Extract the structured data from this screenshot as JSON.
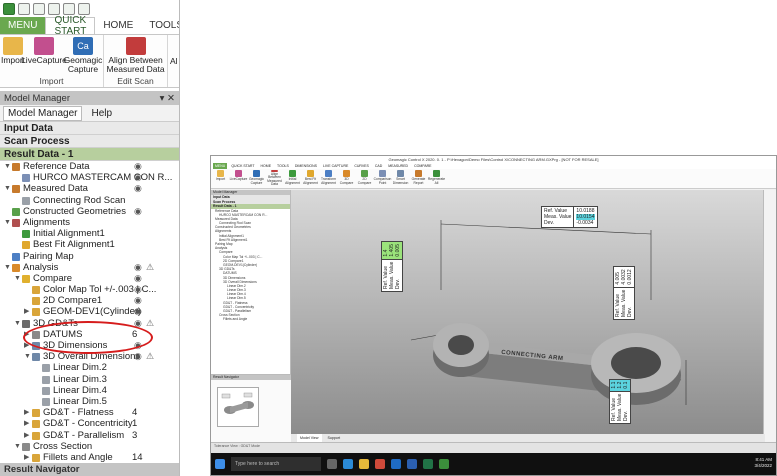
{
  "ribbon": {
    "tabs": [
      "MENU",
      "QUICK START",
      "HOME",
      "TOOLS"
    ],
    "groups": [
      {
        "label": "Import",
        "buttons": [
          {
            "label": "Import"
          },
          {
            "label": "LiveCapture"
          },
          {
            "label": "Geomagic Capture"
          }
        ]
      },
      {
        "label": "Edit Scan",
        "buttons": [
          {
            "label": "Align Between Measured Data"
          }
        ]
      }
    ],
    "clipped_text": "Al"
  },
  "model_manager": {
    "title": "Model Manager",
    "pin": "▾ ✕",
    "tabs": [
      "Model Manager",
      "Help"
    ],
    "sections": [
      "Input Data",
      "Scan Process",
      "Result Data - 1"
    ],
    "tree": [
      {
        "label": "Reference Data",
        "indent": 1,
        "arrow": "▼",
        "icon": "#c77a2c",
        "eye": true
      },
      {
        "label": "HURCO MASTERCAM CON R...",
        "indent": 2,
        "arrow": "",
        "icon": "#7b8fb5",
        "eye": true
      },
      {
        "label": "Measured Data",
        "indent": 1,
        "arrow": "▼",
        "icon": "#c77a2c",
        "eye": true
      },
      {
        "label": "Connecting Rod Scan",
        "indent": 2,
        "arrow": "",
        "icon": "#9aa0a8",
        "eye": false
      },
      {
        "label": "Constructed Geometries",
        "indent": 1,
        "arrow": "",
        "icon": "#59a04a",
        "eye": true
      },
      {
        "label": "Alignments",
        "indent": 1,
        "arrow": "▼",
        "icon": "#b04f4f",
        "eye": false
      },
      {
        "label": "Initial Alignment1",
        "indent": 2,
        "arrow": "",
        "icon": "#3d9a3d",
        "eye": false
      },
      {
        "label": "Best Fit Alignment1",
        "indent": 2,
        "arrow": "",
        "icon": "#e0a82e",
        "eye": false
      },
      {
        "label": "Pairing Map",
        "indent": 1,
        "arrow": "",
        "icon": "#4d7fc4",
        "eye": false
      },
      {
        "label": "Analysis",
        "indent": 1,
        "arrow": "▼",
        "icon": "#d98a2a",
        "eye": true,
        "warn": true
      },
      {
        "label": "Compare",
        "indent": 2,
        "arrow": "▼",
        "icon": "#e0b02e",
        "eye": true
      },
      {
        "label": "Color Map Tol +/-.003 | C...",
        "indent": 3,
        "arrow": "",
        "icon": "#d9a53a",
        "eye": true
      },
      {
        "label": "2D Compare1",
        "indent": 3,
        "arrow": "",
        "icon": "#d9a53a",
        "eye": true
      },
      {
        "label": "GEOM-DEV1(Cylinder)",
        "indent": 3,
        "arrow": "▶",
        "icon": "#d9a53a",
        "eye": true
      },
      {
        "label": "3D GD&Ts",
        "indent": 2,
        "arrow": "▼",
        "icon": "#6b6b6b",
        "eye": true,
        "warn": true
      },
      {
        "label": "DATUMS",
        "indent": 3,
        "arrow": "▶",
        "icon": "#8a8a8a",
        "num": "6"
      },
      {
        "label": "3D Dimensions",
        "indent": 3,
        "arrow": "▶",
        "icon": "#6f88a8",
        "eye": true
      },
      {
        "label": "3D Overall Dimensions",
        "indent": 3,
        "arrow": "▼",
        "icon": "#6f88a8",
        "eye": true,
        "warn": true
      },
      {
        "label": "Linear Dim.2",
        "indent": 4,
        "arrow": "",
        "icon": "#9aa0a8",
        "eye": false
      },
      {
        "label": "Linear Dim.3",
        "indent": 4,
        "arrow": "",
        "icon": "#9aa0a8",
        "eye": false
      },
      {
        "label": "Linear Dim.4",
        "indent": 4,
        "arrow": "",
        "icon": "#9aa0a8",
        "eye": false
      },
      {
        "label": "Linear Dim.5",
        "indent": 4,
        "arrow": "",
        "icon": "#9aa0a8",
        "eye": false
      },
      {
        "label": "GD&T - Flatness",
        "indent": 3,
        "arrow": "▶",
        "icon": "#d9a53a",
        "num": "4"
      },
      {
        "label": "GD&T - Concentricity",
        "indent": 3,
        "arrow": "▶",
        "icon": "#d9a53a",
        "num": "1"
      },
      {
        "label": "GD&T - Parallelism",
        "indent": 3,
        "arrow": "▶",
        "icon": "#d9a53a",
        "num": "3"
      },
      {
        "label": "Cross Section",
        "indent": 2,
        "arrow": "▼",
        "icon": "#8a8a8a",
        "eye": false
      },
      {
        "label": "Fillets and Angle",
        "indent": 3,
        "arrow": "▶",
        "icon": "#d9a53a",
        "num": "14"
      }
    ],
    "bottom_title": "Result Navigator"
  },
  "mini_screen": {
    "title": "Geomagic Control X 2020. 0. 1 - P:\\Hexagon\\Demo Files\\Control X\\CONNECTING ARM.GXPrg - [NOT FOR RESALE]",
    "tabs": [
      "MENU",
      "QUICK START",
      "HOME",
      "TOOLS",
      "DIMENSIONS",
      "LIVE CAPTURE",
      "CURVES",
      "CAD",
      "MEASURED",
      "COMPARE"
    ],
    "ribbon_buttons": [
      "Import",
      "LiveCapture",
      "Geomagic Capture",
      "Align Between Measured Data",
      "Initial Alignment",
      "Best Fit Alignment",
      "Transform Alignment",
      "3D Compare",
      "2D Compare",
      "Comparison Point",
      "Smart Dimension",
      "Generate Report",
      "Regenerate All"
    ],
    "panel_sections": [
      "Model Manager",
      "Input Data",
      "Scan Process",
      "Result Data - 1"
    ],
    "panel_lines": [
      "Reference Data",
      "HURCO MASTERCAM CON R...",
      "Measured Data",
      "Connecting Rod Scan",
      "Constructed Geometries",
      "Alignments",
      "Initial Alignment1",
      "Best Fit Alignment1",
      "Pairing Map",
      "Analysis",
      "Compare",
      "Color Map Tol +/-.003 | C...",
      "2D Compare1",
      "GEOM-DEV1(Cylinder)",
      "3D GD&Ts",
      "DATUMS",
      "3D Dimensions",
      "3D Overall Dimensions",
      "Linear Dim.2",
      "Linear Dim.3",
      "Linear Dim.4",
      "Linear Dim.5",
      "GD&T - Flatness",
      "GD&T - Concentricity",
      "GD&T - Parallelism",
      "Cross Section",
      "Fillets and Angle"
    ],
    "nav_title": "Result Navigator",
    "view_tabs": [
      "Model View",
      "Support"
    ],
    "status": "Tolerance View : GD&T Mode",
    "taskbar_search": "Type here to search",
    "clock": {
      "time": "8:41 AM",
      "date": "3/4/2022"
    },
    "engraving": "CONNECTING ARM",
    "annotations": [
      {
        "labels": [
          "Ref. Value",
          "Meas. Value",
          "Dev."
        ],
        "values": [
          "10.0188",
          "10.0154",
          "-0.0034"
        ],
        "color": "#ffffff"
      },
      {
        "labels": [
          "Ref. Value",
          "Meas. Value",
          "Dev."
        ],
        "values": [
          "1.4",
          "1.405",
          "0.005"
        ],
        "color": "#9be37b"
      },
      {
        "labels": [
          "Ref. Value",
          "Meas. Value",
          "Dev."
        ],
        "values": [
          "4.005",
          "4.0032",
          "0.0012"
        ],
        "color": "#ffffff"
      },
      {
        "labels": [
          "Ref. Value",
          "Meas. Value",
          "Dev."
        ],
        "values": [
          "1.1",
          "1.2",
          "0.1"
        ],
        "color": "#5bd3de"
      }
    ]
  }
}
